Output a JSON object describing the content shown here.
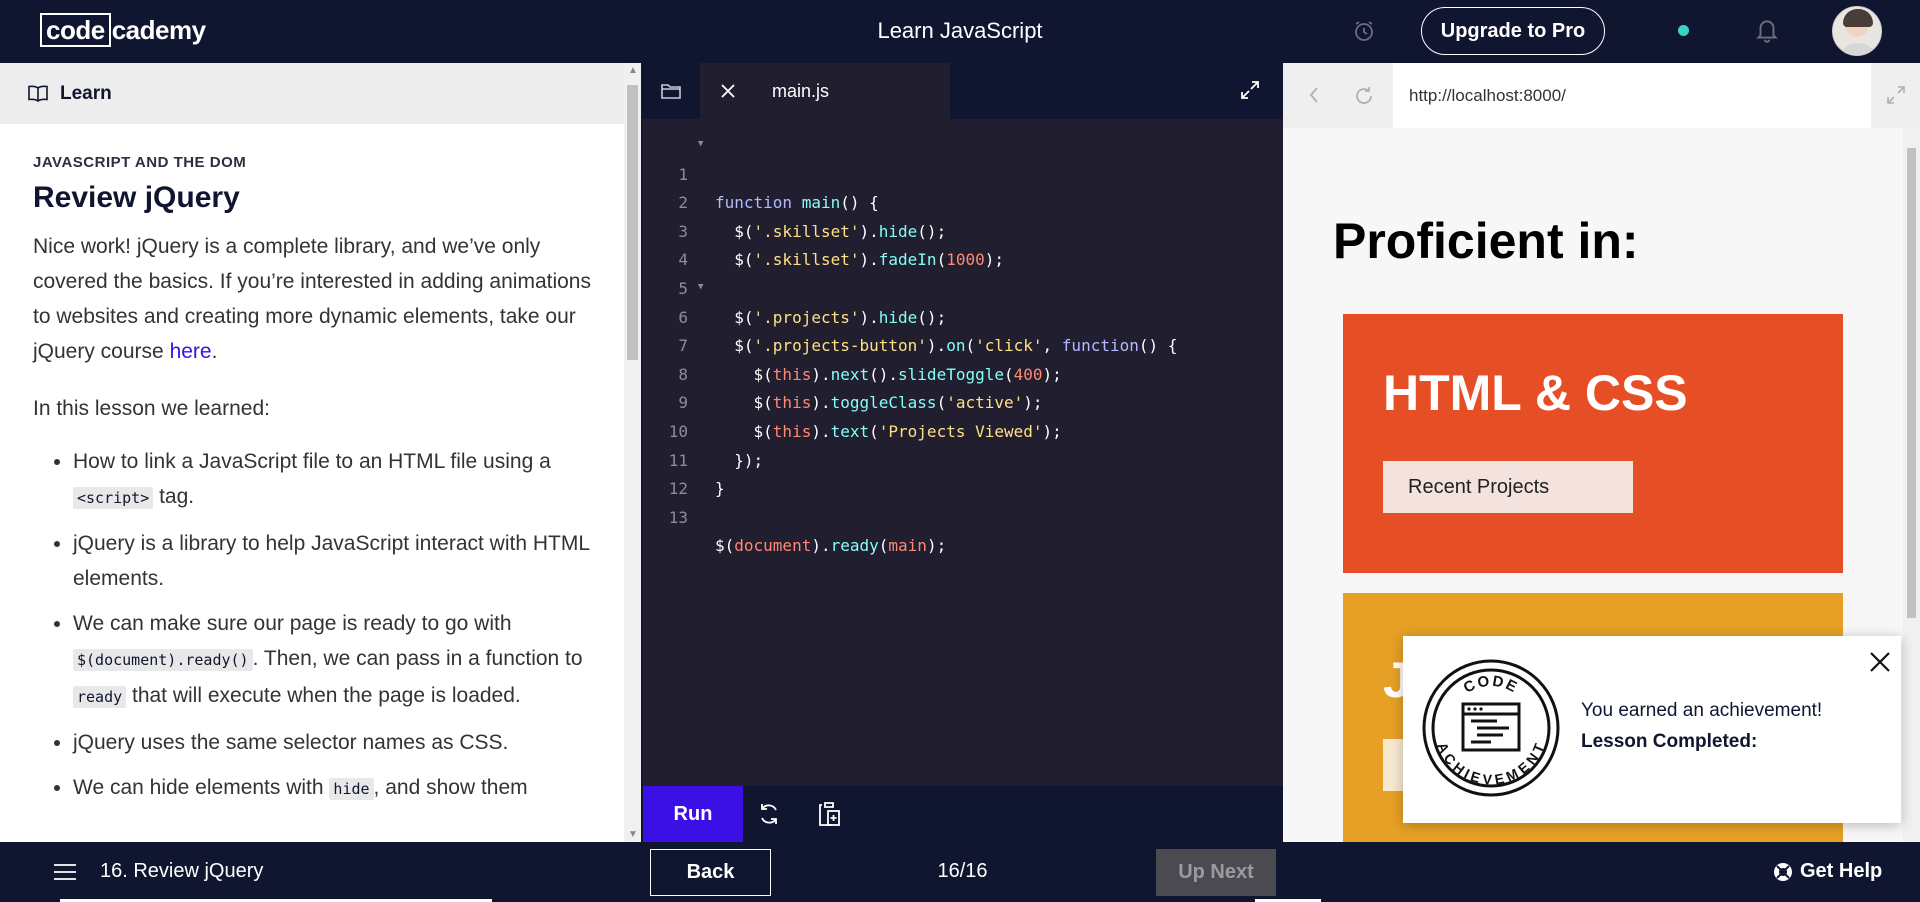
{
  "app": {
    "logo_box": "code",
    "logo_rest": "cademy",
    "course_title": "Learn JavaScript",
    "upgrade_label": "Upgrade to Pro",
    "accent_color": "#3a10e5",
    "status_dot_color": "#3ad2c7"
  },
  "learn": {
    "header_label": "Learn",
    "eyebrow": "JAVASCRIPT AND THE DOM",
    "title": "Review jQuery",
    "intro_text": "Nice work! jQuery is a complete library, and we’ve only covered the basics. If you’re interested in adding animations to websites and creating more dynamic elements, take our jQuery course ",
    "intro_link": "here",
    "intro_end": ".",
    "learned_heading": "In this lesson we learned:",
    "bullets": [
      {
        "before": "How to link a JavaScript file to an HTML file using a ",
        "code": "<script>",
        "after": " tag."
      },
      {
        "text": "jQuery is a library to help JavaScript interact with HTML elements."
      },
      {
        "before": "We can make sure our page is ready to go with ",
        "code": "$(document).ready()",
        "middle": ". Then, we can pass in a function to ",
        "code2": "ready",
        "after": " that will execute when the page is loaded."
      },
      {
        "text": "jQuery uses the same selector names as CSS."
      },
      {
        "before": "We can hide elements with ",
        "code": "hide",
        "after": ", and show them"
      }
    ]
  },
  "editor": {
    "file_name": "main.js",
    "run_label": "Run",
    "lines": [
      {
        "n": "1",
        "fold": true
      },
      {
        "n": "2"
      },
      {
        "n": "3"
      },
      {
        "n": "4"
      },
      {
        "n": "5"
      },
      {
        "n": "6",
        "fold": true
      },
      {
        "n": "7"
      },
      {
        "n": "8"
      },
      {
        "n": "9"
      },
      {
        "n": "10"
      },
      {
        "n": "11"
      },
      {
        "n": "12"
      },
      {
        "n": "13"
      }
    ],
    "code_tokens": {
      "l1": [
        "function",
        " main",
        "() {"
      ],
      "l2": [
        "  $(",
        "'.skillset'",
        ").",
        "hide",
        "();"
      ],
      "l3": [
        "  $(",
        "'.skillset'",
        ").",
        "fadeIn",
        "(",
        "1000",
        ");"
      ],
      "l5": [
        "  $(",
        "'.projects'",
        ").",
        "hide",
        "();"
      ],
      "l6": [
        "  $(",
        "'.projects-button'",
        ").",
        "on",
        "(",
        "'click'",
        ", ",
        "function",
        "() {"
      ],
      "l7": [
        "    $(",
        "this",
        ").",
        "next",
        "().",
        "slideToggle",
        "(",
        "400",
        ");"
      ],
      "l8": [
        "    $(",
        "this",
        ").",
        "toggleClass",
        "(",
        "'active'",
        ");"
      ],
      "l9": [
        "    $(",
        "this",
        ").",
        "text",
        "(",
        "'Projects Viewed'",
        ");"
      ],
      "l10": [
        "  });"
      ],
      "l11": [
        "}"
      ],
      "l13": [
        "$(",
        "document",
        ").",
        "ready",
        "(",
        "main",
        ");"
      ]
    }
  },
  "browser": {
    "url": "http://localhost:8000/",
    "heading": "Proficient in:",
    "cards": [
      {
        "title": "HTML & CSS",
        "button": "Recent Projects",
        "color": "#e64f25"
      },
      {
        "title": "J",
        "button": "",
        "color": "#e6a025"
      }
    ]
  },
  "toast": {
    "badge_top": "CODE",
    "badge_bottom": "ACHIEVEMENT",
    "message": "You earned an achievement!",
    "lesson": "Lesson Completed:"
  },
  "footer": {
    "lesson": "16. Review jQuery",
    "back_label": "Back",
    "progress": "16/16",
    "next_label": "Up Next",
    "help_label": "Get Help"
  }
}
